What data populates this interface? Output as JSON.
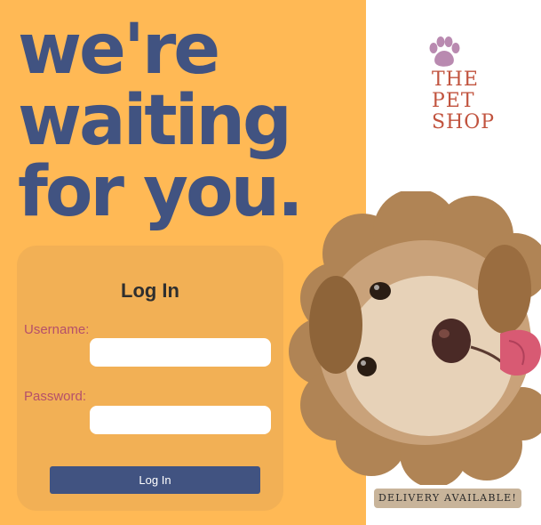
{
  "headline": {
    "line1": "we're",
    "line2": "waiting",
    "line3": "for you."
  },
  "login": {
    "title": "Log In",
    "username_label": "Username:",
    "username_value": "",
    "password_label": "Password:",
    "password_value": "",
    "button_label": "Log In"
  },
  "brand": {
    "logo_icon": "paw-icon",
    "line1": "THE",
    "line2": "PET",
    "line3": "SHOP"
  },
  "hero": {
    "image_icon": "dog-photo"
  },
  "badge": {
    "text": "DELIVERY AVAILABLE!"
  },
  "colors": {
    "panel": "#ffb955",
    "card": "#f2b055",
    "headline": "#415381",
    "button": "#415381",
    "label": "#b5506a",
    "logo_text": "#c1533e",
    "paw": "#b98ab0",
    "badge": "#c8b49a"
  }
}
